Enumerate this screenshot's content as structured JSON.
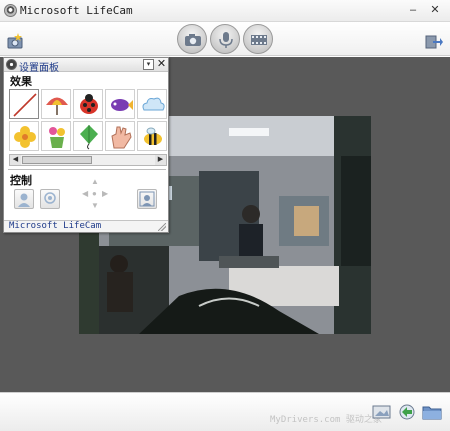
{
  "window": {
    "title": "Microsoft LifeCam",
    "minimize_glyph": "–",
    "close_glyph": "✕"
  },
  "toolbar": {
    "buttons": [
      {
        "icon": "camera-icon"
      },
      {
        "icon": "microphone-icon"
      },
      {
        "icon": "video-record-icon"
      }
    ],
    "left_icon": "effects-settings-icon",
    "right_icon": "exit-to-gallery-icon"
  },
  "settings_panel": {
    "title": "设置面板",
    "dropdown_glyph": "▾",
    "close_glyph": "✕",
    "effects_label": "效果",
    "effects": [
      {
        "icon": "no-effect-icon"
      },
      {
        "icon": "umbrella-icon"
      },
      {
        "icon": "ladybug-icon"
      },
      {
        "icon": "fish-icon"
      },
      {
        "icon": "cloud-icon"
      },
      {
        "icon": "flower-icon"
      },
      {
        "icon": "flower-pot-icon"
      },
      {
        "icon": "kite-icon"
      },
      {
        "icon": "hand-icon"
      },
      {
        "icon": "bee-icon"
      }
    ],
    "scroll_left_glyph": "◀",
    "scroll_right_glyph": "▶",
    "controls_label": "控制",
    "pan_glyphs": {
      "up": "▲",
      "down": "▼",
      "left": "◀",
      "right": "▶",
      "center": "●"
    },
    "footer": "Microsoft LifeCam"
  },
  "bottom_bar": {
    "watermark": "MyDrivers.com 驱动之家",
    "icons": [
      "capture-to-gallery-icon",
      "share-icon",
      "folder-icon"
    ]
  },
  "colors": {
    "workspace_bg": "#595959",
    "title_text": "#222222",
    "panel_title": "#1f3b8a"
  }
}
